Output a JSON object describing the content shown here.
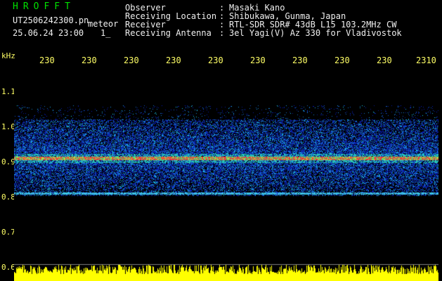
{
  "header": {
    "station": "HROFFT",
    "filename": "UT2506242300.pn",
    "mode": "meteor",
    "datetime": "25.06.24 23:00",
    "counter": "1_",
    "info": [
      {
        "label": "Observer",
        "value": "Masaki Kano"
      },
      {
        "label": "Receiving Location",
        "value": "Shibukawa, Gunma, Japan"
      },
      {
        "label": "Receiver",
        "value": "RTL-SDR SDR# 43dB L15 103.2MHz CW"
      },
      {
        "label": "Receiving Antenna",
        "value": "3el Yagi(V) Az 330 for Vladivostok"
      }
    ],
    "colon": ":"
  },
  "axes": {
    "frequency_unit": "kHz",
    "time_ticks": [
      "230",
      "230",
      "230",
      "230",
      "230",
      "230",
      "230",
      "230",
      "230",
      "2310"
    ],
    "freq_ticks": [
      "1.1",
      "1.0",
      "0.9",
      "0.8",
      "0.7",
      "0.6"
    ]
  },
  "colors": {
    "text_primary": "#f0f0f0",
    "text_accent": "#00e000",
    "tick_labels": "#ffff66",
    "signal_band": "#ff4040",
    "noise_band": "#1f3fb0",
    "amplitude": "#ffff00"
  },
  "spectrogram": {
    "band_top_khz": 1.02,
    "band_bottom_khz": 0.81,
    "carrier_khz": 0.91,
    "secondary_line_khz": 0.81
  }
}
